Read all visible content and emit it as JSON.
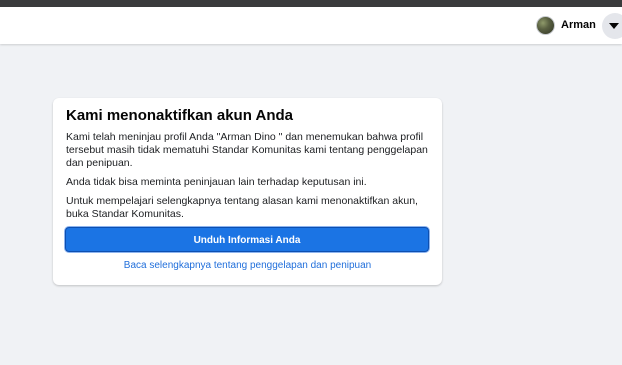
{
  "header": {
    "profile_name": "Arman"
  },
  "card": {
    "title": "Kami menonaktifkan akun Anda",
    "paragraph_1": "Kami telah meninjau profil Anda \"Arman Dino \" dan menemukan bahwa profil tersebut masih tidak mematuhi Standar Komunitas kami tentang penggelapan dan penipuan.",
    "paragraph_2": "Anda tidak bisa meminta peninjauan lain terhadap keputusan ini.",
    "paragraph_3": "Untuk mempelajari selengkapnya tentang alasan kami menonaktifkan akun, buka Standar Komunitas.",
    "download_button_label": "Unduh Informasi Anda",
    "learn_more_link": "Baca selengkapnya tentang penggelapan dan penipuan"
  },
  "icons": {
    "menu": "chevron-down-icon",
    "avatar": "avatar"
  },
  "colors": {
    "background": "#f0f2f5",
    "primary_button": "#1b74e4",
    "link": "#216fdb"
  }
}
